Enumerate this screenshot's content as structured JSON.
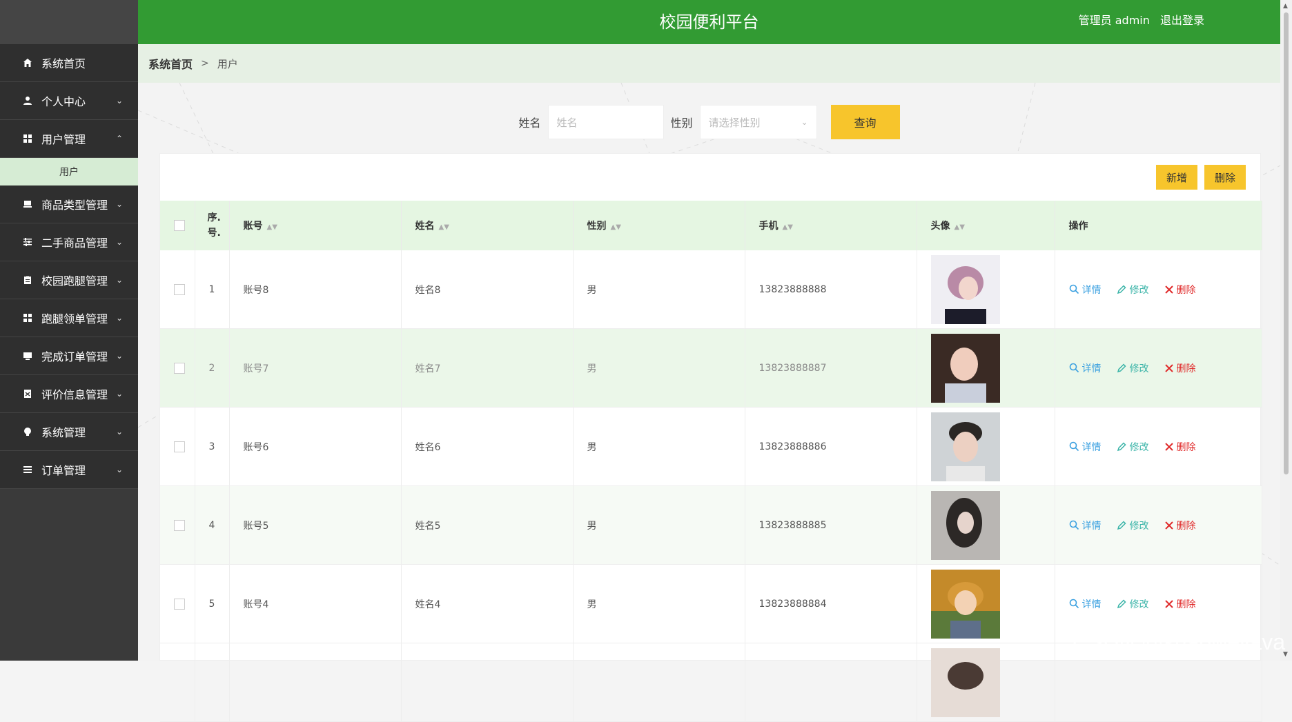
{
  "topbar": {
    "title": "校园便利平台",
    "user_label": "管理员 admin",
    "logout": "退出登录"
  },
  "sidebar": {
    "items": [
      {
        "label": "系统首页",
        "icon": "home-icon"
      },
      {
        "label": "个人中心",
        "icon": "user-icon"
      },
      {
        "label": "用户管理",
        "icon": "grid-icon",
        "expanded": true,
        "sub": "用户"
      },
      {
        "label": "商品类型管理",
        "icon": "box-icon"
      },
      {
        "label": "二手商品管理",
        "icon": "sliders-icon"
      },
      {
        "label": "校园跑腿管理",
        "icon": "clipboard-icon"
      },
      {
        "label": "跑腿领单管理",
        "icon": "grid-icon"
      },
      {
        "label": "完成订单管理",
        "icon": "monitor-icon"
      },
      {
        "label": "评价信息管理",
        "icon": "doc-icon"
      },
      {
        "label": "系统管理",
        "icon": "bulb-icon"
      },
      {
        "label": "订单管理",
        "icon": "list-icon"
      }
    ]
  },
  "breadcrumb": {
    "home": "系统首页",
    "sep": ">",
    "current": "用户"
  },
  "search": {
    "name_label": "姓名",
    "name_placeholder": "姓名",
    "gender_label": "性别",
    "gender_placeholder": "请选择性别",
    "query_button": "查询"
  },
  "toolbar": {
    "add": "新增",
    "delete": "删除"
  },
  "table": {
    "headers": {
      "index": "序.号.",
      "account": "账号",
      "name": "姓名",
      "gender": "性别",
      "phone": "手机",
      "avatar": "头像",
      "ops": "操作"
    },
    "ops": {
      "detail": "详情",
      "edit": "修改",
      "delete": "删除"
    },
    "rows": [
      {
        "index": "1",
        "account": "账号8",
        "name": "姓名8",
        "gender": "男",
        "phone": "13823888888"
      },
      {
        "index": "2",
        "account": "账号7",
        "name": "姓名7",
        "gender": "男",
        "phone": "13823888887"
      },
      {
        "index": "3",
        "account": "账号6",
        "name": "姓名6",
        "gender": "男",
        "phone": "13823888886"
      },
      {
        "index": "4",
        "account": "账号5",
        "name": "姓名5",
        "gender": "男",
        "phone": "13823888885"
      },
      {
        "index": "5",
        "account": "账号4",
        "name": "姓名4",
        "gender": "男",
        "phone": "13823888884"
      }
    ]
  },
  "watermark": "CSDN @shaoweijava",
  "colors": {
    "primary": "#329b33",
    "accent": "#f7c52c",
    "sidebar": "#2f2f2f"
  }
}
